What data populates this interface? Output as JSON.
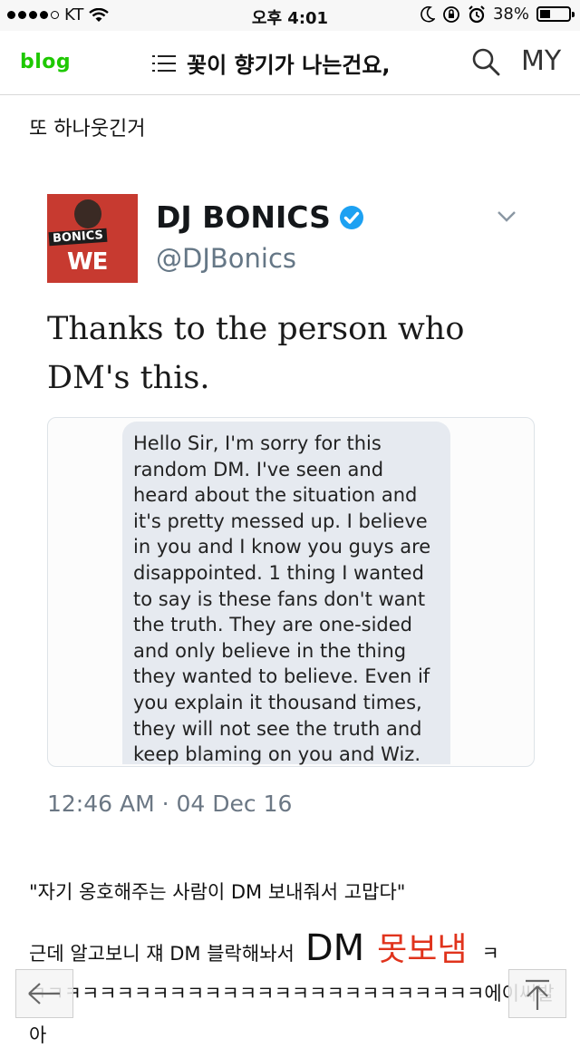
{
  "status_bar": {
    "carrier": "KT",
    "time": "오후 4:01",
    "battery_percent": "38%",
    "battery_level": 0.38
  },
  "nav": {
    "logo": "blog",
    "title": "꽃이 향기가 나는건요,",
    "my_label": "MY"
  },
  "post": {
    "caption": "또 하나웃긴거",
    "quote_line": "\"자기 옹호해주는 사람이 DM 보내줘서 고맙다\"",
    "line2_prefix": "근데 알고보니 쟤 DM 블락해놔서",
    "line2_big": "DM",
    "line2_red": "못보냄",
    "line2_suffix": "ㅋ",
    "line3": "ㅋㅋㅋㅋㅋㅋㅋㅋㅋㅋㅋㅋㅋㅋㅋㅋㅋㅋㅋㅋㅋㅋㅋㅋㅋㅋ에이씨발",
    "line4": "아"
  },
  "tweet": {
    "avatar_label": "BONICS",
    "avatar_big": "WE",
    "name": "DJ BONICS",
    "handle": "@DJBonics",
    "text_line1": "Thanks to the person who",
    "text_line2": "DM's this.",
    "dm_lines": [
      "Hello Sir, I'm sorry for this",
      "random DM. I've seen and",
      "heard about the situation and",
      "it's pretty messed up. I believe",
      "in you and I know you guys are",
      "disappointed. 1 thing I wanted",
      "to say is these fans don't want",
      "the truth. They are one-sided",
      "and only believe in the thing",
      "they wanted to believe. Even if",
      "you explain it thousand times,",
      "they will not see the truth and",
      "keep blaming on you and Wiz."
    ],
    "timestamp": "12:46 AM · 04 Dec 16"
  },
  "colors": {
    "logo_green": "#1ec800",
    "verified_blue": "#1da1f2",
    "red_text": "#e0331c"
  },
  "icons": [
    "wifi-icon",
    "moon-icon",
    "orientation-lock-icon",
    "alarm-icon",
    "battery-icon",
    "menu-icon",
    "search-icon",
    "verified-badge-icon",
    "chevron-down-icon",
    "arrow-left-icon",
    "arrow-up-icon"
  ]
}
